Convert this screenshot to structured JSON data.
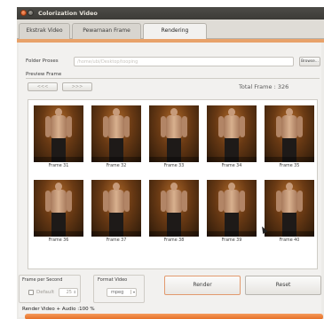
{
  "window": {
    "title": "Colorization Video"
  },
  "tabs": [
    {
      "label": "Ekstrak Video"
    },
    {
      "label": "Pewarnaan Frame"
    },
    {
      "label": "Rendering"
    }
  ],
  "active_tab": "Rendering",
  "folder": {
    "label": "Folder Proses",
    "value": "/home/ubi/Desktop/tooping",
    "browse_label": "Browse..."
  },
  "preview": {
    "label": "Preview Frame",
    "prev_label": "<<<",
    "next_label": ">>>",
    "total_frame_text": "Total Frame :  326"
  },
  "frames": [
    "Frame 31",
    "Frame 32",
    "Frame 33",
    "Frame 34",
    "Frame 35",
    "Frame 36",
    "Frame 37",
    "Frame 38",
    "Frame 39",
    "Frame 40"
  ],
  "fps": {
    "label": "Frame per Second",
    "default_label": "Default",
    "default_checked": false,
    "value": "25"
  },
  "format": {
    "label": "Format Video",
    "selected": "mpeg"
  },
  "buttons": {
    "render": "Render",
    "reset": "Reset"
  },
  "status": {
    "text": "Render Video + Audio  :100  %",
    "progress_percent": 100
  },
  "colors": {
    "accent": "#e2691f",
    "titlebar": "#3c3b37"
  }
}
